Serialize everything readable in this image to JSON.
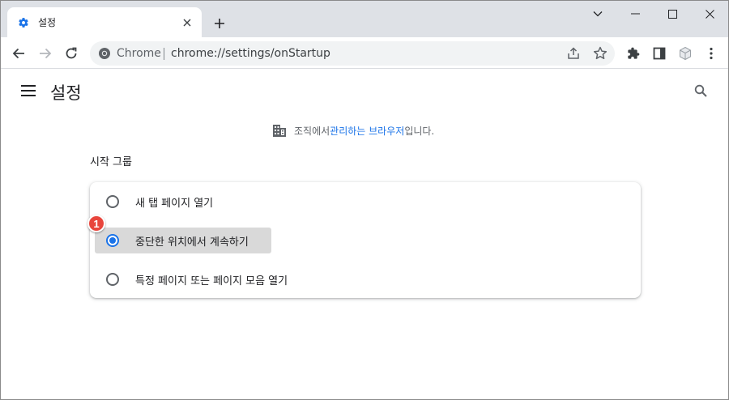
{
  "tab": {
    "title": "설정"
  },
  "toolbar": {
    "omnibox_site": "Chrome",
    "omnibox_url": "chrome://settings/onStartup"
  },
  "page": {
    "title": "설정"
  },
  "managed_notice": {
    "prefix": "조직에서 ",
    "link": "관리하는 브라우저",
    "suffix": "입니다."
  },
  "startup": {
    "section_title": "시작 그룹",
    "options": [
      {
        "label": "새 탭 페이지 열기",
        "checked": false
      },
      {
        "label": "중단한 위치에서 계속하기",
        "checked": true
      },
      {
        "label": "특정 페이지 또는 페이지 모음 열기",
        "checked": false
      }
    ]
  },
  "annotation": {
    "badge": "1"
  },
  "colors": {
    "accent": "#1a73e8",
    "badge": "#e8453c",
    "tabstrip": "#dee1e6"
  }
}
